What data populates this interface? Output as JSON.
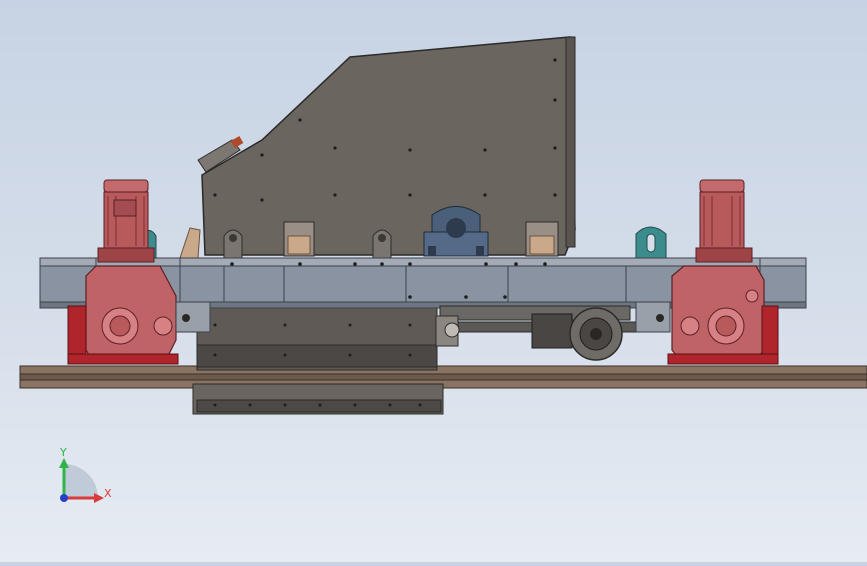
{
  "app": {
    "view": "3d-model-viewport",
    "background_top": "#c7d3e4",
    "background_bottom": "#e7ecf3"
  },
  "colors": {
    "housing": "#6b6560",
    "housing_edge": "#2c2a28",
    "frame": "#8a93a1",
    "motor": "#b8595b",
    "motor_dark": "#7a3035",
    "bracket_red": "#b0242c",
    "teal_lug": "#3c8c8e",
    "rail": "#7a675a",
    "bearing": "#4a5f7a",
    "wood": "#c9a98a"
  },
  "triad": {
    "y_label": "Y",
    "x_label": "X",
    "y_color": "#2fb34a",
    "x_color": "#d93a3a",
    "origin_color": "#2a3fc9"
  }
}
